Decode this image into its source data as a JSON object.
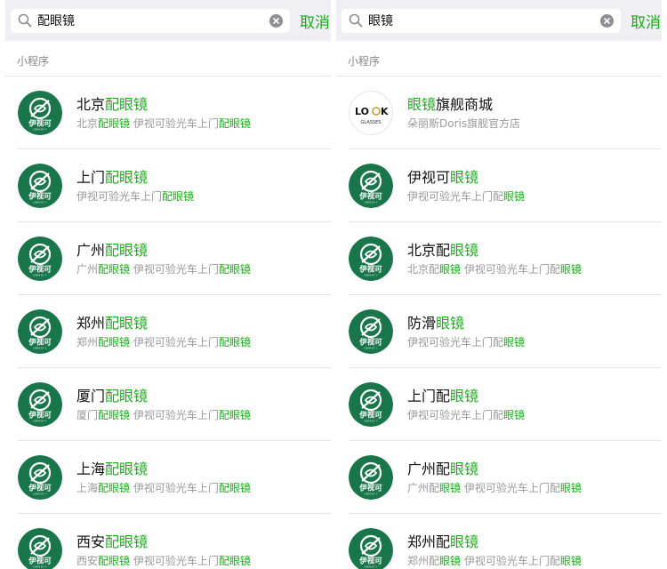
{
  "colors": {
    "accent": "#1aad19",
    "brand_green": "#19764a",
    "bg": "#efeff4"
  },
  "left": {
    "search": {
      "value": "配眼镜",
      "cancel_label": "取消"
    },
    "section_title": "小程序",
    "items": [
      {
        "title": [
          {
            "t": "北京",
            "h": false
          },
          {
            "t": "配眼镜",
            "h": true
          }
        ],
        "desc": [
          {
            "t": "北京",
            "h": false
          },
          {
            "t": "配眼镜",
            "h": true
          },
          {
            "t": " 伊视可验光车上门",
            "h": false
          },
          {
            "t": "配眼镜",
            "h": true
          }
        ],
        "avatar": "eyeseek"
      },
      {
        "title": [
          {
            "t": "上门",
            "h": false
          },
          {
            "t": "配眼镜",
            "h": true
          }
        ],
        "desc": [
          {
            "t": "伊视可验光车上门",
            "h": false
          },
          {
            "t": "配眼镜",
            "h": true
          }
        ],
        "avatar": "eyeseek"
      },
      {
        "title": [
          {
            "t": "广州",
            "h": false
          },
          {
            "t": "配眼镜",
            "h": true
          }
        ],
        "desc": [
          {
            "t": "广州",
            "h": false
          },
          {
            "t": "配眼镜",
            "h": true
          },
          {
            "t": " 伊视可验光车上门",
            "h": false
          },
          {
            "t": "配眼镜",
            "h": true
          }
        ],
        "avatar": "eyeseek"
      },
      {
        "title": [
          {
            "t": "郑州",
            "h": false
          },
          {
            "t": "配眼镜",
            "h": true
          }
        ],
        "desc": [
          {
            "t": "郑州",
            "h": false
          },
          {
            "t": "配眼镜",
            "h": true
          },
          {
            "t": " 伊视可验光车上门",
            "h": false
          },
          {
            "t": "配眼镜",
            "h": true
          }
        ],
        "avatar": "eyeseek"
      },
      {
        "title": [
          {
            "t": "厦门",
            "h": false
          },
          {
            "t": "配眼镜",
            "h": true
          }
        ],
        "desc": [
          {
            "t": "厦门",
            "h": false
          },
          {
            "t": "配眼镜",
            "h": true
          },
          {
            "t": " 伊视可验光车上门",
            "h": false
          },
          {
            "t": "配眼镜",
            "h": true
          }
        ],
        "avatar": "eyeseek"
      },
      {
        "title": [
          {
            "t": "上海",
            "h": false
          },
          {
            "t": "配眼镜",
            "h": true
          }
        ],
        "desc": [
          {
            "t": "上海",
            "h": false
          },
          {
            "t": "配眼镜",
            "h": true
          },
          {
            "t": " 伊视可验光车上门",
            "h": false
          },
          {
            "t": "配眼镜",
            "h": true
          }
        ],
        "avatar": "eyeseek"
      },
      {
        "title": [
          {
            "t": "西安",
            "h": false
          },
          {
            "t": "配眼镜",
            "h": true
          }
        ],
        "desc": [
          {
            "t": "西安",
            "h": false
          },
          {
            "t": "配眼镜",
            "h": true
          },
          {
            "t": " 伊视可验光车上门",
            "h": false
          },
          {
            "t": "配眼镜",
            "h": true
          }
        ],
        "avatar": "eyeseek"
      }
    ]
  },
  "right": {
    "search": {
      "value": "眼镜",
      "cancel_label": "取消"
    },
    "section_title": "小程序",
    "items": [
      {
        "title": [
          {
            "t": "眼镜",
            "h": true
          },
          {
            "t": "旗舰商城",
            "h": false
          }
        ],
        "desc": [
          {
            "t": "朵丽斯Doris旗舰官方店",
            "h": false
          }
        ],
        "avatar": "look"
      },
      {
        "title": [
          {
            "t": "伊视可",
            "h": false
          },
          {
            "t": "眼镜",
            "h": true
          }
        ],
        "desc": [
          {
            "t": "伊视可验光车上门配",
            "h": false
          },
          {
            "t": "眼镜",
            "h": true
          }
        ],
        "avatar": "eyeseek"
      },
      {
        "title": [
          {
            "t": "北京配",
            "h": false
          },
          {
            "t": "眼镜",
            "h": true
          }
        ],
        "desc": [
          {
            "t": "北京配",
            "h": false
          },
          {
            "t": "眼镜",
            "h": true
          },
          {
            "t": " 伊视可验光车上门配",
            "h": false
          },
          {
            "t": "眼镜",
            "h": true
          }
        ],
        "avatar": "eyeseek"
      },
      {
        "title": [
          {
            "t": "防滑",
            "h": false
          },
          {
            "t": "眼镜",
            "h": true
          }
        ],
        "desc": [
          {
            "t": "伊视可验光车上门配",
            "h": false
          },
          {
            "t": "眼镜",
            "h": true
          }
        ],
        "avatar": "eyeseek"
      },
      {
        "title": [
          {
            "t": "上门配",
            "h": false
          },
          {
            "t": "眼镜",
            "h": true
          }
        ],
        "desc": [
          {
            "t": "伊视可验光车上门配",
            "h": false
          },
          {
            "t": "眼镜",
            "h": true
          }
        ],
        "avatar": "eyeseek"
      },
      {
        "title": [
          {
            "t": "广州配",
            "h": false
          },
          {
            "t": "眼镜",
            "h": true
          }
        ],
        "desc": [
          {
            "t": "广州配",
            "h": false
          },
          {
            "t": "眼镜",
            "h": true
          },
          {
            "t": " 伊视可验光车上门配",
            "h": false
          },
          {
            "t": "眼镜",
            "h": true
          }
        ],
        "avatar": "eyeseek"
      },
      {
        "title": [
          {
            "t": "郑州配",
            "h": false
          },
          {
            "t": "眼镜",
            "h": true
          }
        ],
        "desc": [
          {
            "t": "郑州配",
            "h": false
          },
          {
            "t": "眼镜",
            "h": true
          },
          {
            "t": " 伊视可验光车上门配",
            "h": false
          },
          {
            "t": "眼镜",
            "h": true
          }
        ],
        "avatar": "eyeseek"
      }
    ]
  },
  "logos": {
    "eyeseek_text": "伊视可",
    "eyeseek_sub": "GMW-EY·Y",
    "look_text_1": "LO",
    "look_text_2": "K",
    "look_text_3": "GLASSES"
  }
}
